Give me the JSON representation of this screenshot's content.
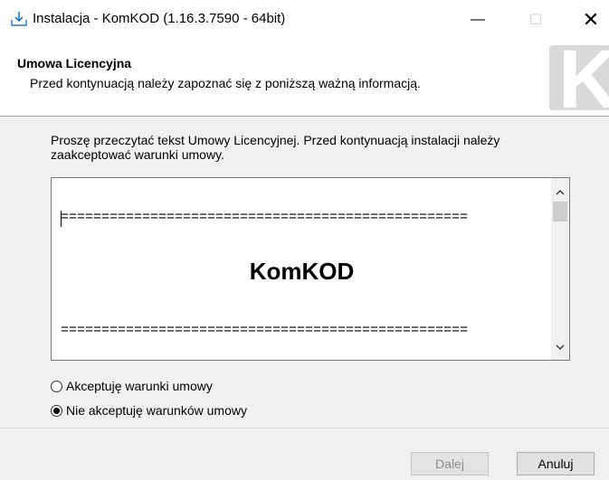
{
  "window": {
    "title": "Instalacja - KomKOD (1.16.3.7590 - 64bit)",
    "icon": "install-download-icon",
    "controls": {
      "minimize": "—",
      "maximize": "☐",
      "close": "✕"
    }
  },
  "header": {
    "title": "Umowa Licencyjna",
    "subtitle": "Przed kontynuacją należy zapoznać się z poniższą ważną informacją.",
    "logo_letter": "K"
  },
  "instructions": "Proszę przeczytać tekst Umowy Licencyjnej. Przed kontynuacją instalacji należy zaakceptować warunki umowy.",
  "license": {
    "separator": "==================================================",
    "heading": "KomKOD"
  },
  "options": [
    {
      "label": "Akceptuję warunki umowy",
      "checked": false
    },
    {
      "label": "Nie akceptuję warunków umowy",
      "checked": true
    }
  ],
  "buttons": {
    "next": "Dalej",
    "cancel": "Anuluj"
  },
  "colors": {
    "background": "#f0f0f0",
    "header": "#ffffff",
    "disabled_text": "#8c8c8c"
  }
}
